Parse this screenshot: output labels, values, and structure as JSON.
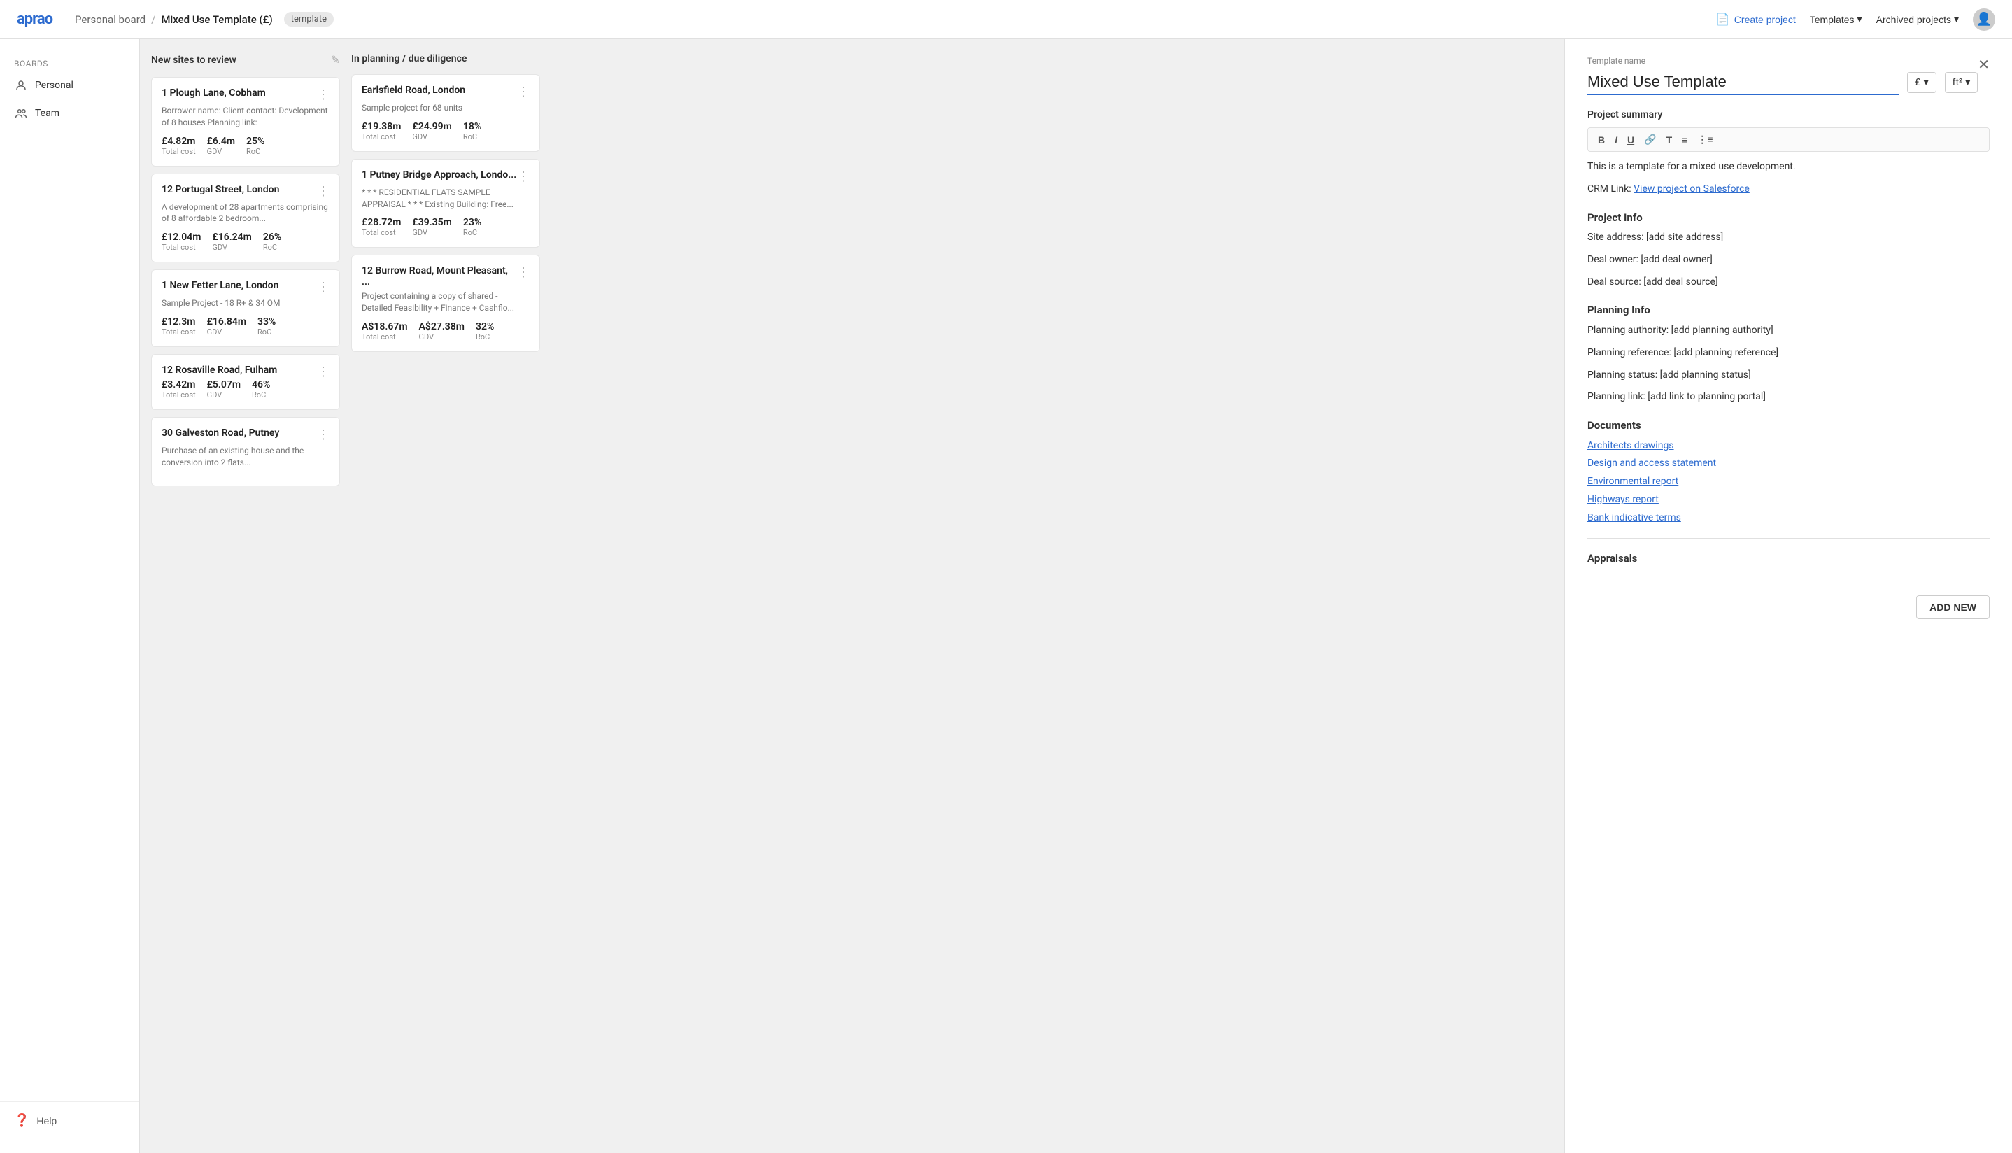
{
  "app": {
    "logo": "aprao",
    "breadcrumb": {
      "parent": "Personal board",
      "separator": "/",
      "current": "Mixed Use Template (£)",
      "tag": "template"
    }
  },
  "topbar": {
    "create_project": "Create project",
    "templates": "Templates",
    "archived_projects": "Archived projects"
  },
  "sidebar": {
    "section_label": "Boards",
    "personal_label": "Personal",
    "team_label": "Team",
    "help_label": "Help"
  },
  "columns": [
    {
      "id": "new-sites",
      "title": "New sites to review",
      "cards": [
        {
          "title": "1 Plough Lane, Cobham",
          "desc": "Borrower name: Client contact: Development of 8 houses Planning link:",
          "stats": [
            {
              "value": "£4.82m",
              "label": "Total cost"
            },
            {
              "value": "£6.4m",
              "label": "GDV"
            },
            {
              "value": "25%",
              "label": "RoC"
            }
          ]
        },
        {
          "title": "12 Portugal Street, London",
          "desc": "A development of 28 apartments comprising of 8 affordable 2 bedroom...",
          "stats": [
            {
              "value": "£12.04m",
              "label": "Total cost"
            },
            {
              "value": "£16.24m",
              "label": "GDV"
            },
            {
              "value": "26%",
              "label": "RoC"
            }
          ]
        },
        {
          "title": "1 New Fetter Lane, London",
          "desc": "Sample Project - 18 R+ & 34 OM",
          "stats": [
            {
              "value": "£12.3m",
              "label": "Total cost"
            },
            {
              "value": "£16.84m",
              "label": "GDV"
            },
            {
              "value": "33%",
              "label": "RoC"
            }
          ]
        },
        {
          "title": "12 Rosaville Road, Fulham",
          "desc": "",
          "stats": [
            {
              "value": "£3.42m",
              "label": "Total cost"
            },
            {
              "value": "£5.07m",
              "label": "GDV"
            },
            {
              "value": "46%",
              "label": "RoC"
            }
          ]
        },
        {
          "title": "30 Galveston Road, Putney",
          "desc": "Purchase of an existing house and the conversion into 2 flats...",
          "stats": []
        }
      ]
    },
    {
      "id": "in-planning",
      "title": "In planning / due diligence",
      "cards": [
        {
          "title": "Earlsfield Road, London",
          "desc": "Sample project for 68 units",
          "stats": [
            {
              "value": "£19.38m",
              "label": "Total cost"
            },
            {
              "value": "£24.99m",
              "label": "GDV"
            },
            {
              "value": "18%",
              "label": "RoC"
            }
          ]
        },
        {
          "title": "1 Putney Bridge Approach, Londo...",
          "desc": "* * * RESIDENTIAL FLATS SAMPLE APPRAISAL * * * Existing Building: Free...",
          "stats": [
            {
              "value": "£28.72m",
              "label": "Total cost"
            },
            {
              "value": "£39.35m",
              "label": "GDV"
            },
            {
              "value": "23%",
              "label": "RoC"
            }
          ]
        },
        {
          "title": "12 Burrow Road, Mount Pleasant, ...",
          "desc": "Project containing a copy of shared - Detailed Feasibility + Finance + Cashflo...",
          "stats": [
            {
              "value": "A$18.67m",
              "label": "Total cost"
            },
            {
              "value": "A$27.38m",
              "label": "GDV"
            },
            {
              "value": "32%",
              "label": "RoC"
            }
          ]
        }
      ]
    }
  ],
  "panel": {
    "template_name_label": "Template name",
    "template_name": "Mixed Use Template",
    "currency": "£",
    "unit": "ft²",
    "project_summary_label": "Project summary",
    "toolbar_buttons": [
      "B",
      "I",
      "U",
      "🔗",
      "T",
      "≡",
      "⋮≡"
    ],
    "content_intro": "This is a template for a mixed use development.",
    "crm_label": "CRM Link:",
    "crm_link_text": "View project on Salesforce",
    "project_info_title": "Project Info",
    "project_info_lines": [
      "Site address: [add site address]",
      "Deal owner: [add deal owner]",
      "Deal source: [add deal source]"
    ],
    "planning_info_title": "Planning Info",
    "planning_info_lines": [
      "Planning authority: [add planning authority]",
      "Planning reference: [add planning reference]",
      "Planning status: [add planning status]",
      "Planning link: [add link to planning portal]"
    ],
    "documents_title": "Documents",
    "documents": [
      "Architects drawings",
      "Design and access statement",
      "Environmental report",
      "Highways report",
      "Bank indicative terms"
    ],
    "appraisals_title": "Appraisals",
    "add_new_label": "ADD NEW"
  }
}
